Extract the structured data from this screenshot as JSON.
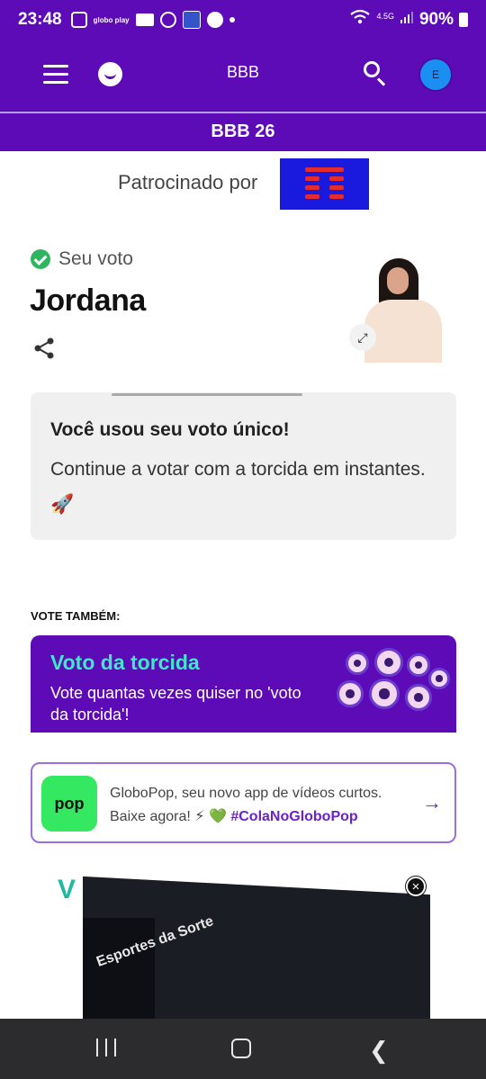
{
  "status_bar": {
    "time": "23:48",
    "globoplay_icon_text": "globo play",
    "network": "4.5G",
    "battery": "90%"
  },
  "header": {
    "title": "BBB",
    "avatar_initial": "E"
  },
  "subheader": {
    "title": "BBB 26"
  },
  "sponsor": {
    "label": "Patrocinado por"
  },
  "vote": {
    "status_label": "Seu voto",
    "candidate_name": "Jordana"
  },
  "message": {
    "title": "Você usou seu voto único!",
    "body": "Continue a votar com a torcida em instantes. 🚀"
  },
  "vote_also": {
    "section_label": "VOTE TAMBÉM:",
    "card_title": "Voto da torcida",
    "card_description": "Vote quantas vezes quiser no 'voto da torcida'!"
  },
  "globopop": {
    "logo_text": "pop",
    "text": "GloboPop, seu novo app de vídeos curtos. Baixe agora! ⚡ 💚",
    "hashtag": "#ColaNoGloboPop"
  },
  "ad": {
    "brand_text": "Esportes da Sorte"
  },
  "colors": {
    "brand_purple": "#5d0bb7",
    "accent_teal": "#3ee8c8",
    "check_green": "#2fb55f",
    "pop_green": "#35e861"
  }
}
